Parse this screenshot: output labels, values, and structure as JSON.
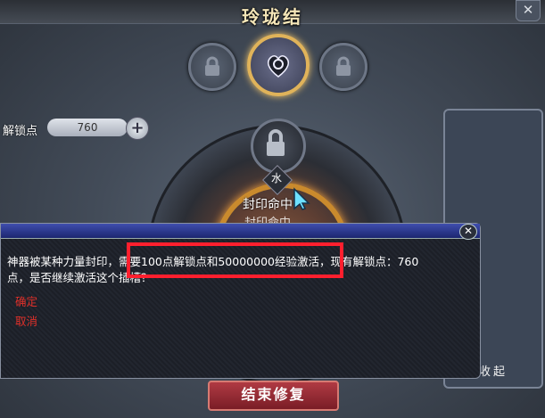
{
  "window": {
    "title": "玲珑结",
    "close_label": "✕"
  },
  "unlock": {
    "label": "解锁点",
    "value": "760",
    "plus_label": "+"
  },
  "wheel": {
    "element": "水",
    "status": "封印命中",
    "status_partial": "封印命中"
  },
  "side_panel": {
    "collapse_label": "收起"
  },
  "main_button": {
    "label": "结束修复"
  },
  "dialog": {
    "close_label": "✕",
    "message_line1": "神器被某种力量封印，需要100点解锁点和50000000经验激活，现有解锁点：760",
    "message_line2": "点，是否继续激活这个插槽？",
    "options": [
      "确定",
      "取消"
    ]
  },
  "icons": [
    "lock-icon",
    "heart-knot-icon",
    "lock-icon",
    "lock-icon"
  ],
  "colors": {
    "accent_gold": "#e0b35a",
    "highlight_red": "#ff1f2e",
    "option_red": "#e0302a",
    "dialog_title_blue": "#2a3a9a"
  }
}
